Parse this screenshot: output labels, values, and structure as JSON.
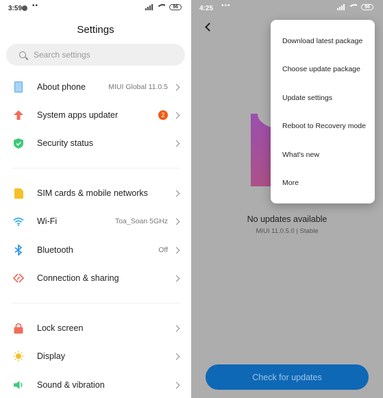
{
  "left_screen": {
    "status_bar": {
      "time": "3:59",
      "dots": "••",
      "battery": "96"
    },
    "title": "Settings",
    "search": {
      "placeholder": "Search settings",
      "value": ""
    },
    "items": [
      {
        "label": "About phone",
        "value": "MIUI Global 11.0.5",
        "icon": "phone-icon",
        "color": "#7ab8f0"
      },
      {
        "label": "System apps updater",
        "badge": "2",
        "icon": "arrow-up-icon",
        "color": "#f26d5b"
      },
      {
        "label": "Security status",
        "icon": "shield-check-icon",
        "color": "#3cc97a"
      },
      {
        "label": "SIM cards & mobile networks",
        "icon": "sim-card-icon",
        "color": "#f5c028"
      },
      {
        "label": "Wi-Fi",
        "value": "Toa_Soan 5GHz",
        "icon": "wifi-icon",
        "color": "#2fa9e8"
      },
      {
        "label": "Bluetooth",
        "value": "Off",
        "icon": "bluetooth-icon",
        "color": "#2f94e8"
      },
      {
        "label": "Connection & sharing",
        "icon": "connection-sharing-icon",
        "color": "#f26d5b"
      },
      {
        "label": "Lock screen",
        "icon": "lock-icon",
        "color": "#f26d5b"
      },
      {
        "label": "Display",
        "icon": "sun-icon",
        "color": "#f5c028"
      },
      {
        "label": "Sound & vibration",
        "icon": "speaker-icon",
        "color": "#3cc97a"
      }
    ]
  },
  "right_screen": {
    "status_bar": {
      "time": "4:25",
      "dots": "•••",
      "battery": "96"
    },
    "status_title": "No updates available",
    "version": "MIUI 11.0.5.0 | Stable",
    "check_button": "Check for updates",
    "menu": [
      "Download latest package",
      "Choose update package",
      "Update settings",
      "Reboot to Recovery mode",
      "What's new",
      "More"
    ],
    "accent_color": "#0e68b5"
  }
}
